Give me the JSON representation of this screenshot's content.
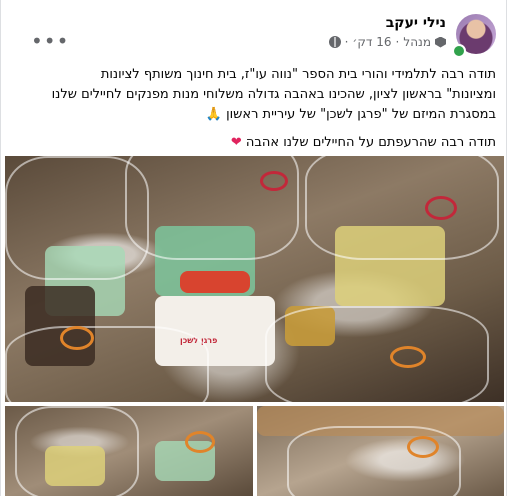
{
  "post": {
    "author_name": "נילי יעקב",
    "role": "מנהל",
    "time": "16 דק׳",
    "separator": "·",
    "more_label": "•••",
    "text_line1": "תודה רבה לתלמידי והורי בית הספר \"נווה עו\"ז, בית חינוך משותף לציונות",
    "text_line2": "ומציונות\" בראשון לציון, שהכינו באהבה גדולה משלוחי מנות מפנקים לחיילים שלנו",
    "text_line3": "במסגרת המיזם של \"פרגן לשכן\" של עיריית ראשון",
    "pray_emoji": "🙏",
    "thanks_text": "תודה רבה שהרעפתם על החיילים שלנו אהבה",
    "heart_emoji": "❤"
  },
  "photos": {
    "main_alt_label": "פרגן לשכן",
    "count_visible": 3
  },
  "colors": {
    "card_bg": "#ffffff",
    "page_bg": "#f0f2f5",
    "text_primary": "#050505",
    "text_secondary": "#65676b",
    "online_green": "#31a24c",
    "heart_red": "#e0245e"
  },
  "icons": {
    "privacy": "globe-icon",
    "admin_badge": "admin-badge-icon",
    "more": "more-options-icon"
  }
}
